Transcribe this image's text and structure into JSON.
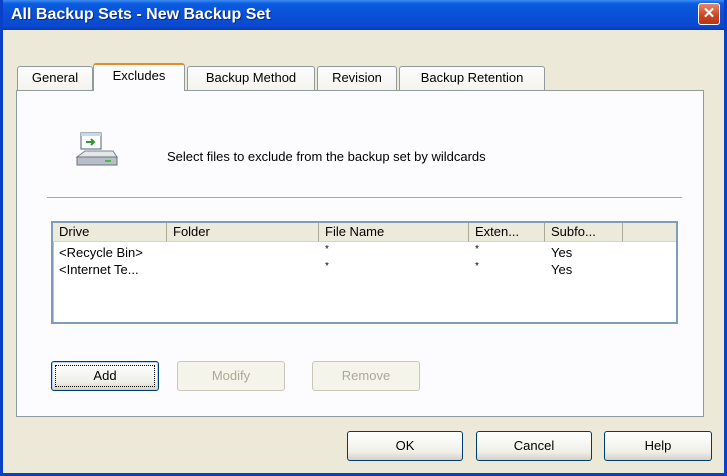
{
  "window": {
    "title": "All Backup Sets - New Backup Set",
    "close_glyph": "✕"
  },
  "tabs": [
    {
      "label": "General",
      "active": false
    },
    {
      "label": "Excludes",
      "active": true
    },
    {
      "label": "Backup Method",
      "active": false
    },
    {
      "label": "Revision",
      "active": false
    },
    {
      "label": "Backup Retention",
      "active": false
    }
  ],
  "excludes": {
    "icon": "drive-exclude-icon",
    "description": "Select files to exclude from the backup set by wildcards",
    "columns": [
      "Drive",
      "Folder",
      "File Name",
      "Exten...",
      "Subfo..."
    ],
    "rows": [
      {
        "drive": "<Recycle Bin>",
        "folder": "",
        "file_name": "*",
        "extension": "*",
        "subfolders": "Yes"
      },
      {
        "drive": "<Internet Te...",
        "folder": "",
        "file_name": "*",
        "extension": "*",
        "subfolders": "Yes"
      }
    ],
    "buttons": {
      "add": "Add",
      "modify": "Modify",
      "remove": "Remove"
    }
  },
  "footer": {
    "ok": "OK",
    "cancel": "Cancel",
    "help": "Help"
  },
  "colors": {
    "titlebar": "#0a4fd6",
    "active_tab_accent": "#e68b2c",
    "window_bg": "#ece9d8"
  }
}
